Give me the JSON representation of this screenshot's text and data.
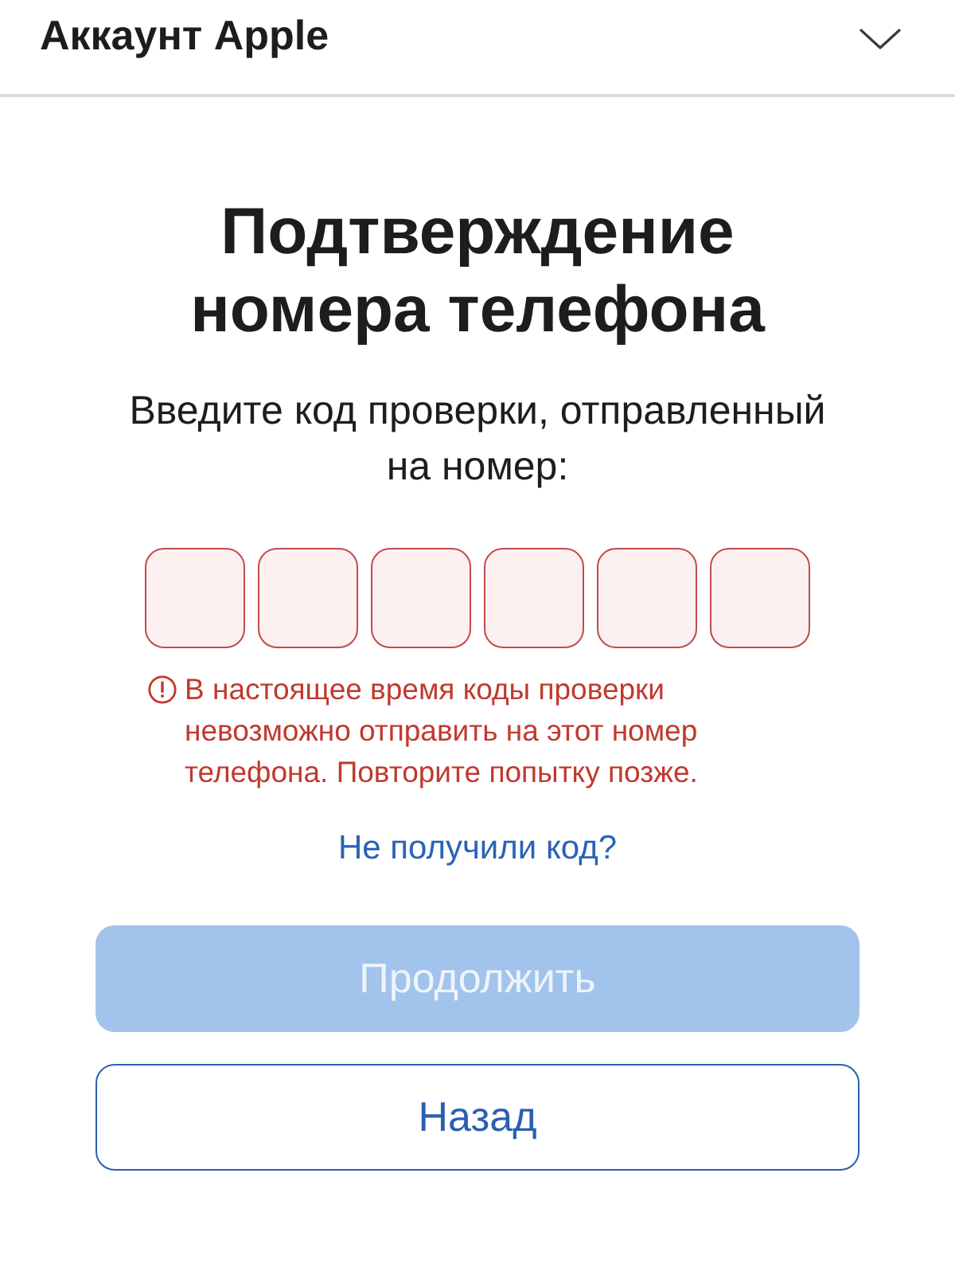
{
  "header": {
    "title": "Аккаунт Apple",
    "expanded": false
  },
  "heading": "Подтверждение номера телефона",
  "instruction": "Введите код проверки, отправленный на номер:",
  "code_fields": [
    {
      "invalid": true
    },
    {
      "invalid": true
    },
    {
      "invalid": true
    },
    {
      "invalid": true
    },
    {
      "invalid": true
    },
    {
      "invalid": true
    }
  ],
  "error_message": "В настоящее время коды проверки невозможно отправить на этот номер телефона. Повторите попытку позже.",
  "resend_link": "Не получили код?",
  "buttons": [
    {
      "label": "Продолжить",
      "kind": "primary",
      "disabled": true
    },
    {
      "label": "Назад",
      "kind": "secondary",
      "disabled": false
    }
  ]
}
